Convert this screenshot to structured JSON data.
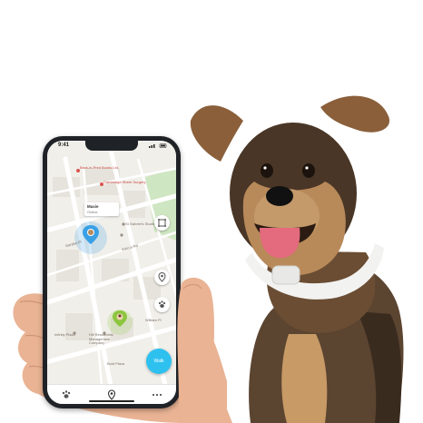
{
  "phone": {
    "status_time": "9:41",
    "map_labels": {
      "poi_1": "Back-in-Print Books Ltd",
      "poi_2": "Cambridge Street Surgery",
      "street_1": "Garden Pl",
      "poi_3": "St Gabriel's Studios",
      "poi_4": "Walcot Rd",
      "poi_5": "William Pi",
      "poi_6": "Infinity Plaza",
      "poi_7": "Hill Residential Management Company",
      "poi_8": "Bold Plaza"
    },
    "callout": {
      "name": "Maxie",
      "status": "Online"
    },
    "walk_button": "Walk",
    "colors": {
      "accent": "#2ec1f0",
      "pet_pin": "#3aa0e6",
      "owner_pin": "#8cc63f"
    },
    "icons": {
      "fence": "fence-icon",
      "location": "location-pin-icon",
      "paw": "paws-icon",
      "tab_home": "paw-tab-icon",
      "tab_map": "map-pin-tab-icon",
      "tab_more": "more-dots-icon"
    }
  }
}
